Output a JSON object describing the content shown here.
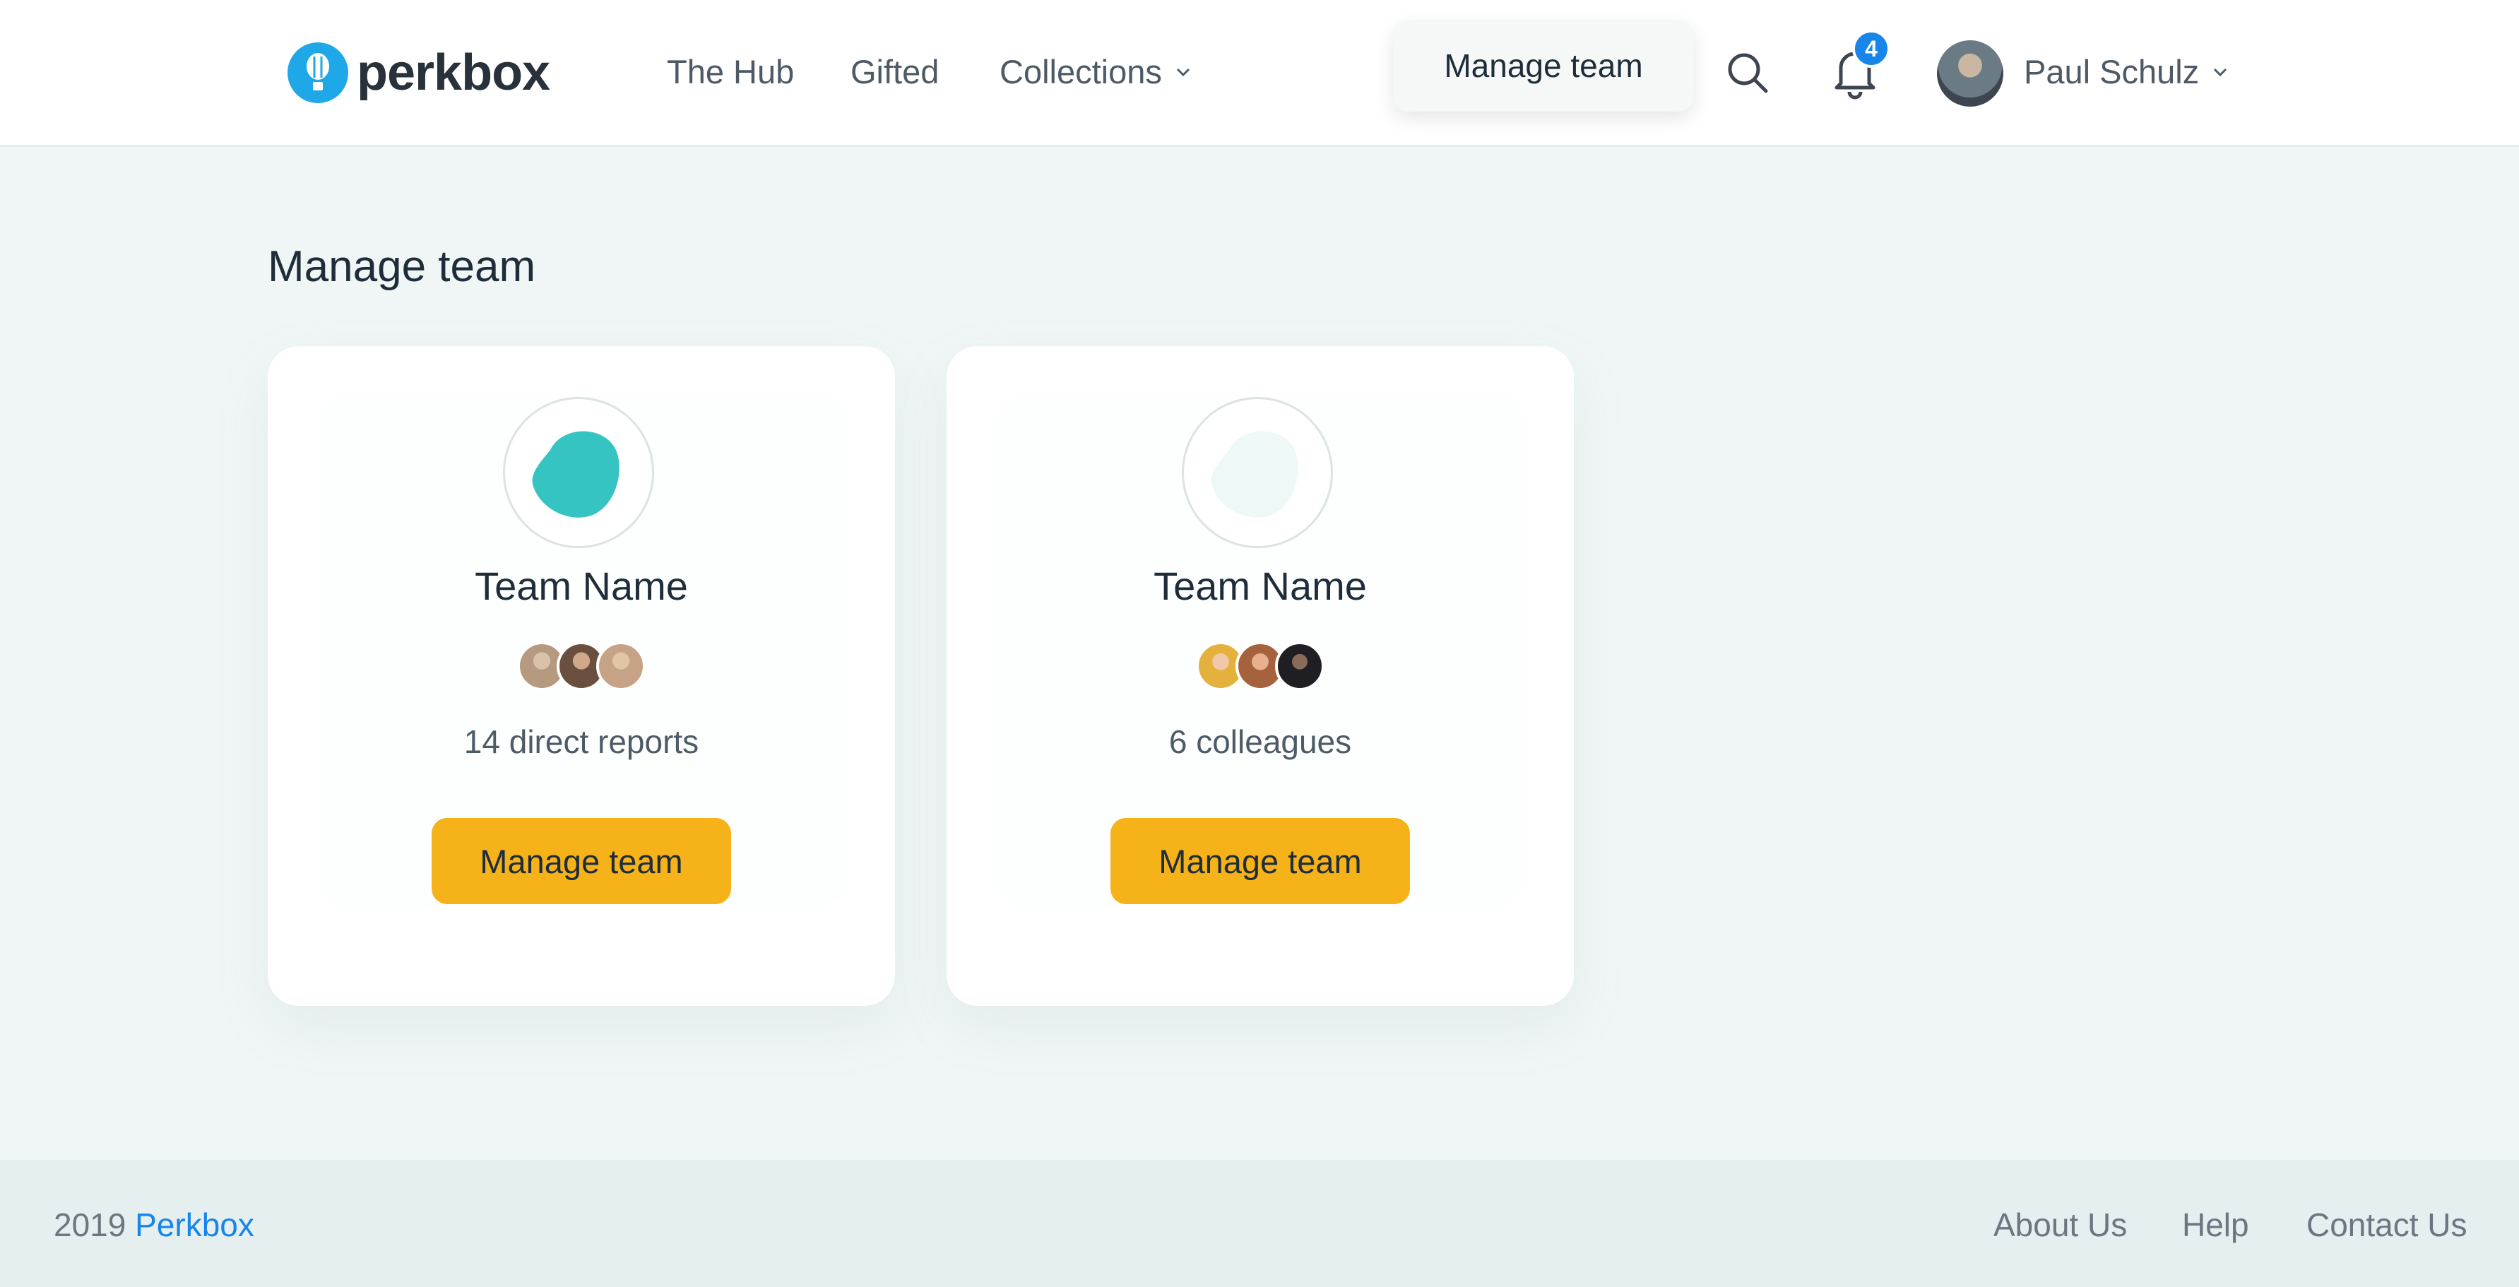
{
  "header": {
    "brand": "perkbox",
    "nav": [
      {
        "label": "The Hub"
      },
      {
        "label": "Gifted"
      },
      {
        "label": "Collections"
      }
    ],
    "manage_team_button": "Manage team",
    "notifications_count": "4",
    "user_name": "Paul Schulz"
  },
  "page": {
    "title": "Manage team"
  },
  "cards": [
    {
      "team_name": "Team Name",
      "count_text": "14 direct reports",
      "button_label": "Manage team",
      "logo_color": "#35c4c2",
      "avatar_colors": [
        "#b59a7f",
        "#6a4e3e",
        "#c6a386"
      ]
    },
    {
      "team_name": "Team Name",
      "count_text": "6 colleagues",
      "button_label": "Manage team",
      "logo_color": "#edf8f7",
      "avatar_colors": [
        "#e4b13c",
        "#a5623d",
        "#1f1f23"
      ]
    }
  ],
  "footer": {
    "year": "2019",
    "brand_link": "Perkbox",
    "links": [
      {
        "label": "About Us"
      },
      {
        "label": "Help"
      },
      {
        "label": "Contact Us"
      }
    ]
  },
  "colors": {
    "accent_yellow": "#f6b319",
    "link_blue": "#1785ea",
    "logo_blue": "#1ea8e8",
    "background": "#f0f6f6"
  }
}
